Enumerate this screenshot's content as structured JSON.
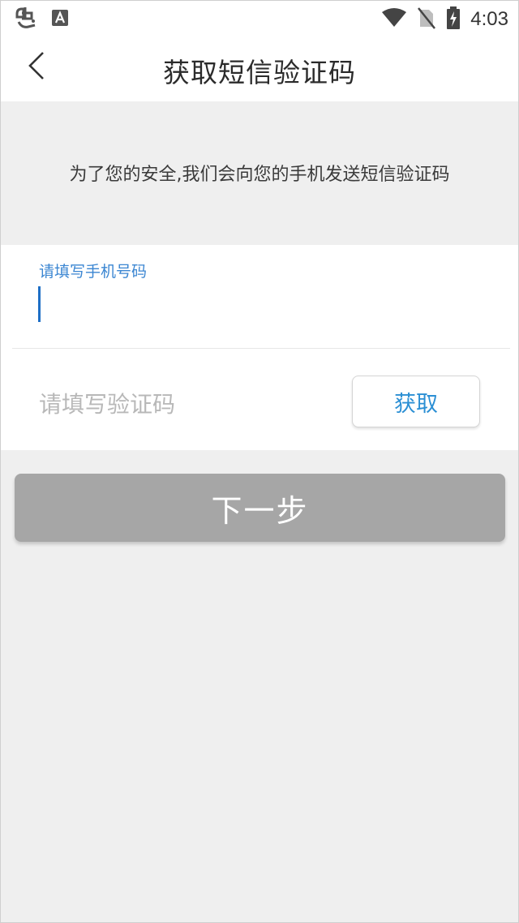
{
  "status_bar": {
    "time": "4:03",
    "left_icons": [
      "app-logo-icon",
      "notification-a-icon"
    ],
    "right_icons": [
      "wifi-icon",
      "no-sim-icon",
      "battery-charging-icon"
    ]
  },
  "header": {
    "back_icon": "chevron-left-icon",
    "title": "获取短信验证码"
  },
  "notice": {
    "text": "为了您的安全,我们会向您的手机发送短信验证码"
  },
  "form": {
    "phone_label": "请填写手机号码",
    "phone_value": "",
    "code_placeholder": "请填写验证码",
    "code_value": "",
    "get_code_label": "获取"
  },
  "actions": {
    "next_label": "下一步"
  },
  "colors": {
    "accent": "#2b8fd4",
    "label_blue": "#3b86d2",
    "disabled_button": "#a6a6a6",
    "background": "#efefef"
  }
}
